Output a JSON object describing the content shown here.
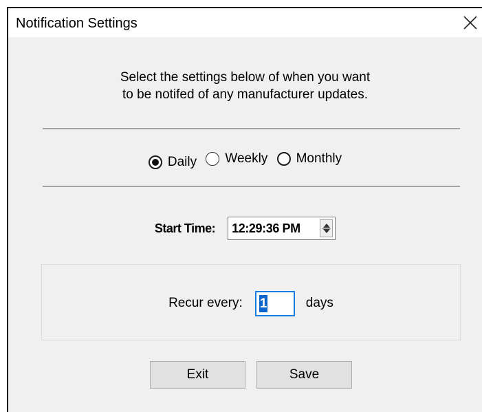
{
  "window": {
    "title": "Notification Settings",
    "close_icon": "close-icon"
  },
  "intro": {
    "line1": "Select the settings below of when you want",
    "line2": "to be notifed of any manufacturer updates."
  },
  "frequency": {
    "selected": "Daily",
    "options": [
      "Daily",
      "Weekly",
      "Monthly"
    ]
  },
  "start_time": {
    "label": "Start Time:",
    "value": "12:29:36 PM"
  },
  "recur": {
    "label": "Recur every:",
    "value": "1",
    "unit": "days"
  },
  "buttons": {
    "exit": "Exit",
    "save": "Save"
  },
  "colors": {
    "dialog_bg": "#f0f0f0",
    "selection_blue": "#0a64c9",
    "focus_border": "#1a7ee0"
  }
}
